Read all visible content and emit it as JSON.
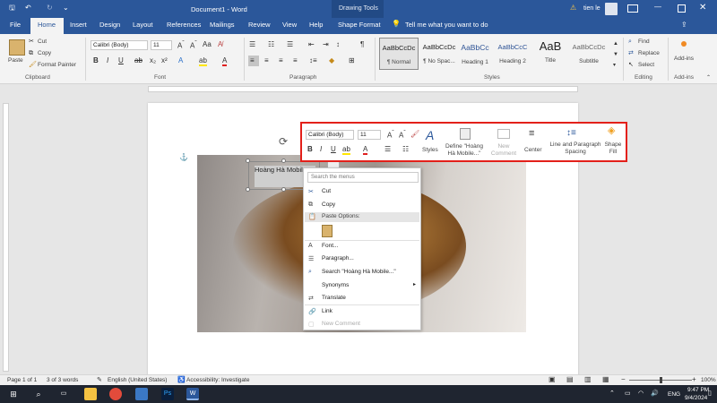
{
  "title_bar": {
    "document_title": "Document1 - Word",
    "context_title": "Drawing Tools",
    "search_prompt": "Tell me what you want to do",
    "user": "tien le"
  },
  "tabs": [
    "File",
    "Home",
    "Insert",
    "Design",
    "Layout",
    "References",
    "Mailings",
    "Review",
    "View",
    "Help",
    "Shape Format"
  ],
  "ribbon": {
    "clipboard": {
      "paste": "Paste",
      "cut": "Cut",
      "copy": "Copy",
      "format_painter": "Format Painter",
      "group": "Clipboard"
    },
    "font": {
      "name": "Calibri (Body)",
      "size": "11",
      "group": "Font"
    },
    "paragraph": {
      "group": "Paragraph"
    },
    "styles": {
      "items": [
        {
          "preview": "AaBbCcDc",
          "name": "¶ Normal"
        },
        {
          "preview": "AaBbCcDc",
          "name": "¶ No Spac..."
        },
        {
          "preview": "AaBbCc",
          "name": "Heading 1"
        },
        {
          "preview": "AaBbCcC",
          "name": "Heading 2"
        },
        {
          "preview": "AaB",
          "name": "Title"
        },
        {
          "preview": "AaBbCcDc",
          "name": "Subtitle"
        }
      ],
      "group": "Styles"
    },
    "editing": {
      "find": "Find",
      "replace": "Replace",
      "select": "Select",
      "group": "Editing"
    },
    "addins": {
      "label": "Add-ins",
      "group": "Add-ins"
    }
  },
  "textbox": {
    "text": "Hoàng Hà Mobile"
  },
  "mini_toolbar": {
    "font": "Calibri (Body)",
    "size": "11",
    "styles": "Styles",
    "define": "Define \"Hoàng Hà Mobile...\"",
    "new_comment": "New Comment",
    "center": "Center",
    "line_spacing": "Line and Paragraph Spacing",
    "shape_fill": "Shape Fill"
  },
  "context_menu": {
    "search_placeholder": "Search the menus",
    "cut": "Cut",
    "copy": "Copy",
    "paste_options": "Paste Options:",
    "font": "Font...",
    "paragraph": "Paragraph...",
    "search": "Search \"Hoàng Hà Mobile...\"",
    "synonyms": "Synonyms",
    "translate": "Translate",
    "link": "Link",
    "new_comment": "New Comment"
  },
  "status_bar": {
    "page": "Page 1 of 1",
    "words": "3 of 3 words",
    "language": "English (United States)",
    "accessibility": "Accessibility: Investigate",
    "zoom": "100%"
  },
  "taskbar": {
    "language": "ENG",
    "time": "9:47 PM",
    "date": "9/4/2024"
  }
}
